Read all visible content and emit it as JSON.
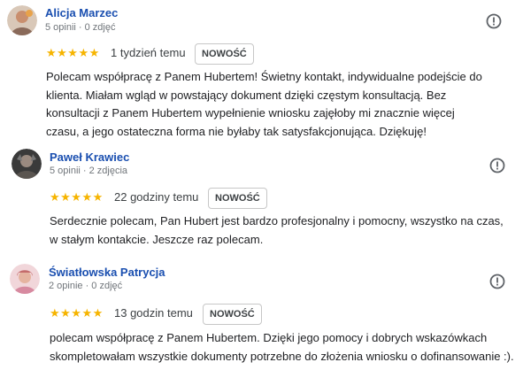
{
  "colors": {
    "author_link": "#1a4fb0",
    "stars": "#f6b400",
    "meta_text": "#70757a",
    "badge_border": "#c7c7c7"
  },
  "reviews": [
    {
      "author": "Alicja Marzec",
      "meta": "5 opinii · 0 zdjęć",
      "stars": "★★★★★",
      "rating": 5,
      "time": "1 tydzień temu",
      "badge": "NOWOŚĆ",
      "text": "Polecam współpracę z Panem Hubertem! Świetny kontakt, indywidualne podejście do klienta. Miałam wgląd w powstający dokument dzięki częstym konsultacją. Bez konsultacji z Panem Hubertem wypełnienie wniosku zajęłoby mi znacznie więcej czasu, a jego ostateczna forma nie byłaby tak satysfakcjonująca. Dziękuję!",
      "avatar_icon": "user-photo-avatar",
      "flag_icon": "report-flag-icon"
    },
    {
      "author": "Paweł Krawiec",
      "meta": "5 opinii · 2 zdjęcia",
      "stars": "★★★★★",
      "rating": 5,
      "time": "22 godziny temu",
      "badge": "NOWOŚĆ",
      "text": "Serdecznie polecam, Pan Hubert jest bardzo profesjonalny i pomocny, wszystko na czas, w stałym kontakcie. Jeszcze raz polecam.",
      "avatar_icon": "user-photo-avatar",
      "flag_icon": "report-flag-icon"
    },
    {
      "author": "Światłowska Patrycja",
      "meta": "2 opinie · 0 zdjęć",
      "stars": "★★★★★",
      "rating": 5,
      "time": "13 godzin temu",
      "badge": "NOWOŚĆ",
      "text": "polecam współpracę z Panem Hubertem. Dzięki jego pomocy i dobrych wskazówkach skompletowałam wszystkie dokumenty potrzebne do złożenia wniosku o dofinansowanie :).",
      "avatar_icon": "user-photo-avatar",
      "flag_icon": "report-flag-icon"
    }
  ]
}
